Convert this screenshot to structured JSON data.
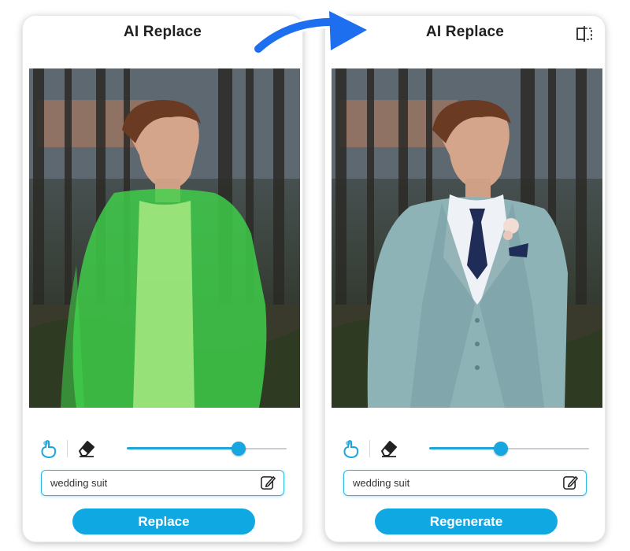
{
  "colors": {
    "accent": "#0fa8e2",
    "selection_overlay": "#3fd24a",
    "arrow": "#1d6ff0",
    "suit": "#8db3b7"
  },
  "left_panel": {
    "title": "AI Replace",
    "tools": {
      "brush_icon": "hand-brush-icon",
      "eraser_icon": "eraser-icon"
    },
    "brush_size": 0.7,
    "prompt_value": "wedding suit",
    "prompt_icon": "edit-icon",
    "button_label": "Replace"
  },
  "right_panel": {
    "title": "AI Replace",
    "compare_icon": "compare-icon",
    "tools": {
      "brush_icon": "hand-brush-icon",
      "eraser_icon": "eraser-icon"
    },
    "brush_size": 0.45,
    "prompt_value": "wedding suit",
    "prompt_icon": "edit-icon",
    "button_label": "Regenerate"
  },
  "arrow_icon": "curved-arrow-right-icon"
}
